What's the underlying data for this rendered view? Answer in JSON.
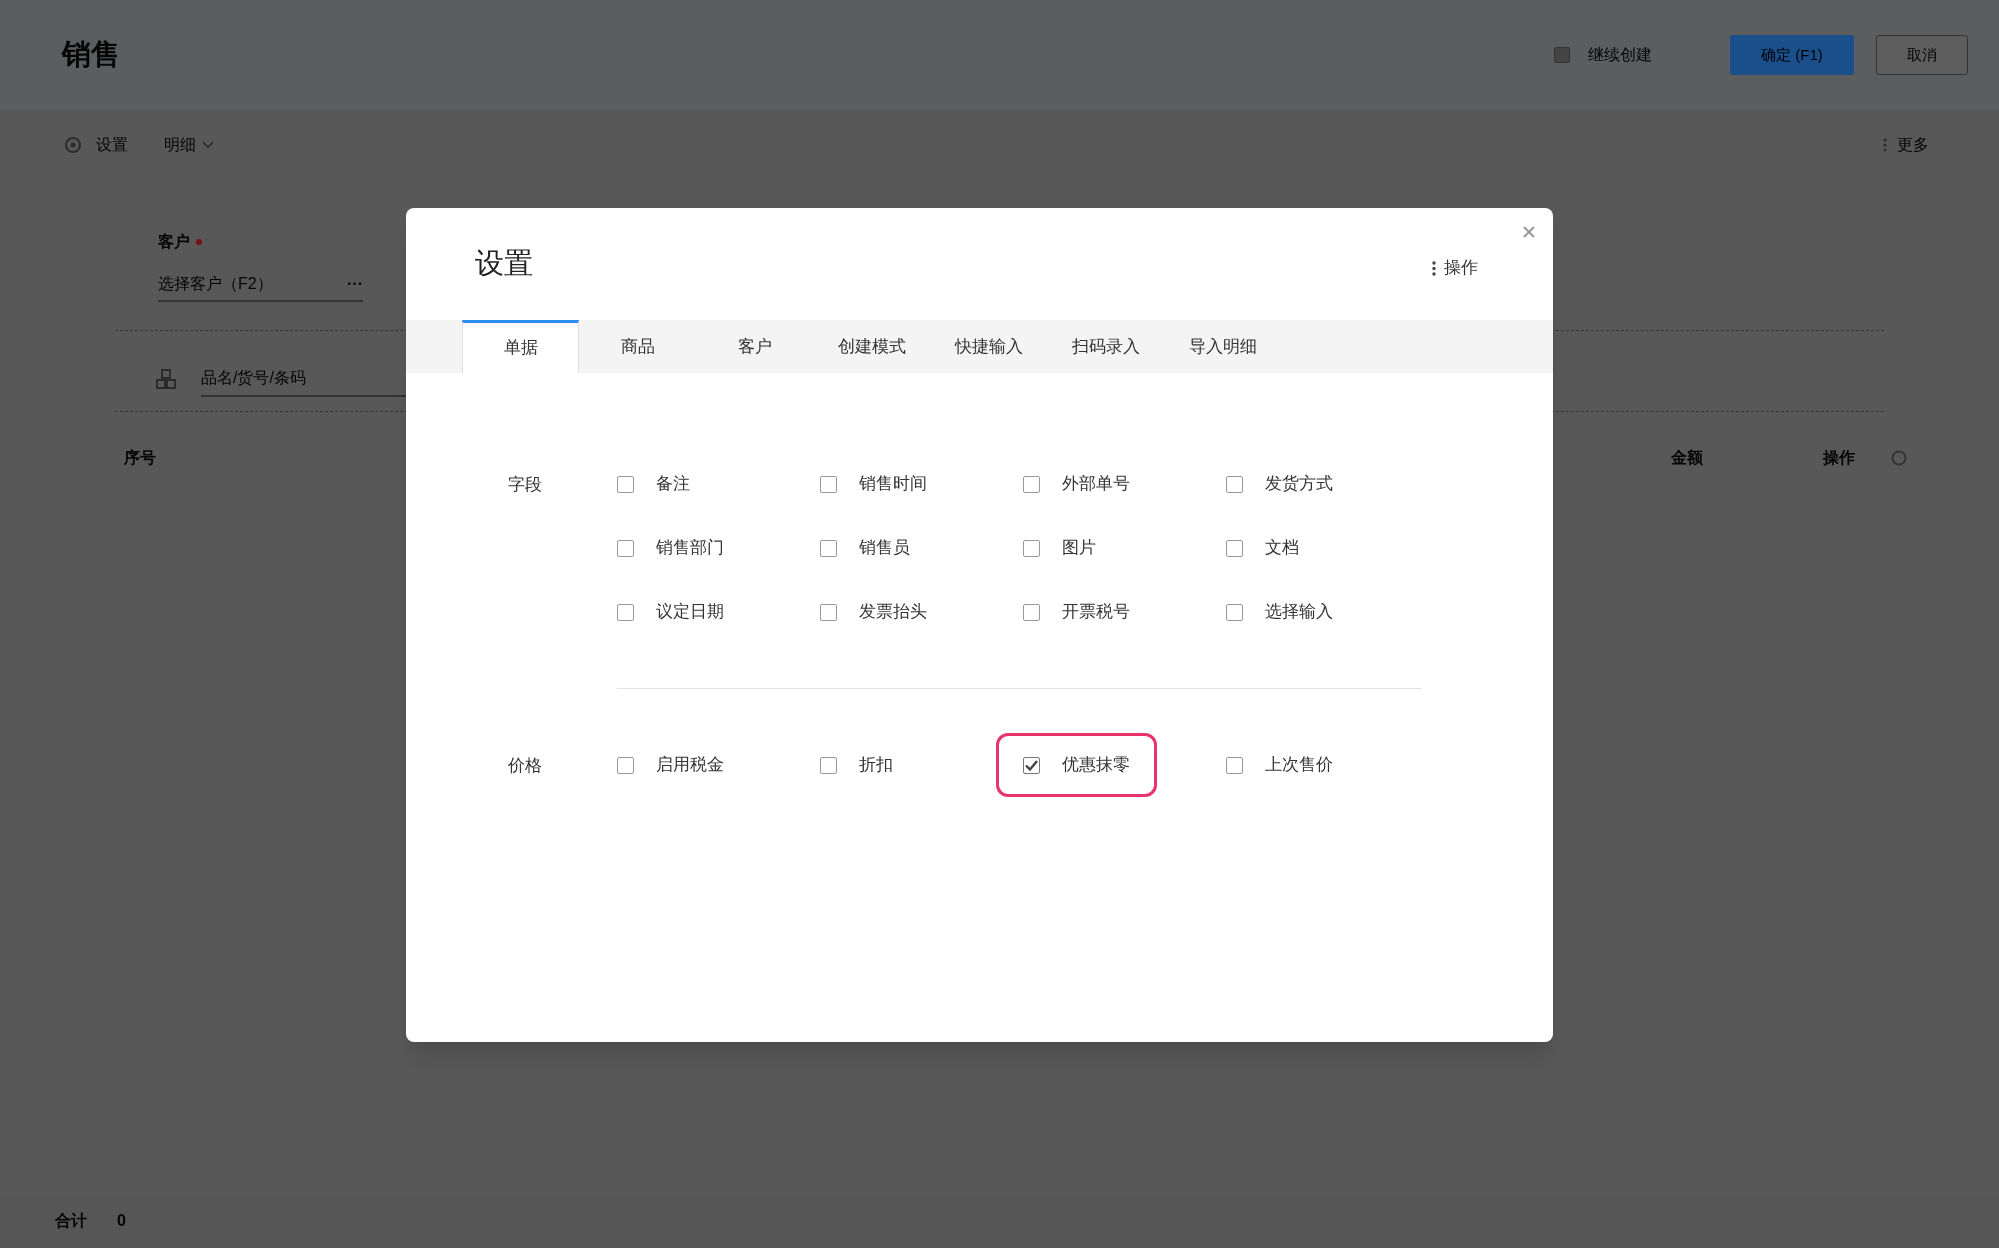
{
  "page": {
    "title": "销售",
    "continue_create": {
      "label": "继续创建",
      "checked": false
    },
    "confirm_button": "确定 (F1)",
    "cancel_button": "取消",
    "toolbar": {
      "settings": "设置",
      "detail": "明细",
      "more": "更多"
    },
    "customer": {
      "label": "客户",
      "required": true,
      "placeholder": "选择客户（F2）",
      "more": "···"
    },
    "product_search": {
      "placeholder": "品名/货号/条码"
    },
    "table": {
      "columns": [
        "序号",
        "金额",
        "操作"
      ]
    },
    "footer": {
      "label": "合计",
      "value": "0"
    }
  },
  "dialog": {
    "title": "设置",
    "action": "操作",
    "tabs": [
      {
        "label": "单据",
        "selected": true
      },
      {
        "label": "商品",
        "selected": false
      },
      {
        "label": "客户",
        "selected": false
      },
      {
        "label": "创建模式",
        "selected": false
      },
      {
        "label": "快捷输入",
        "selected": false
      },
      {
        "label": "扫码录入",
        "selected": false
      },
      {
        "label": "导入明细",
        "selected": false
      }
    ],
    "sections": [
      {
        "label": "字段",
        "options": [
          {
            "label": "备注",
            "checked": false,
            "highlighted": false
          },
          {
            "label": "销售时间",
            "checked": false,
            "highlighted": false
          },
          {
            "label": "外部单号",
            "checked": false,
            "highlighted": false
          },
          {
            "label": "发货方式",
            "checked": false,
            "highlighted": false
          },
          {
            "label": "销售部门",
            "checked": false,
            "highlighted": false
          },
          {
            "label": "销售员",
            "checked": false,
            "highlighted": false
          },
          {
            "label": "图片",
            "checked": false,
            "highlighted": false
          },
          {
            "label": "文档",
            "checked": false,
            "highlighted": false
          },
          {
            "label": "议定日期",
            "checked": false,
            "highlighted": false
          },
          {
            "label": "发票抬头",
            "checked": false,
            "highlighted": false
          },
          {
            "label": "开票税号",
            "checked": false,
            "highlighted": false
          },
          {
            "label": "选择输入",
            "checked": false,
            "highlighted": false
          }
        ]
      },
      {
        "label": "价格",
        "options": [
          {
            "label": "启用税金",
            "checked": false,
            "highlighted": false
          },
          {
            "label": "折扣",
            "checked": false,
            "highlighted": false
          },
          {
            "label": "优惠抹零",
            "checked": true,
            "highlighted": true
          },
          {
            "label": "上次售价",
            "checked": false,
            "highlighted": false
          }
        ]
      }
    ]
  }
}
